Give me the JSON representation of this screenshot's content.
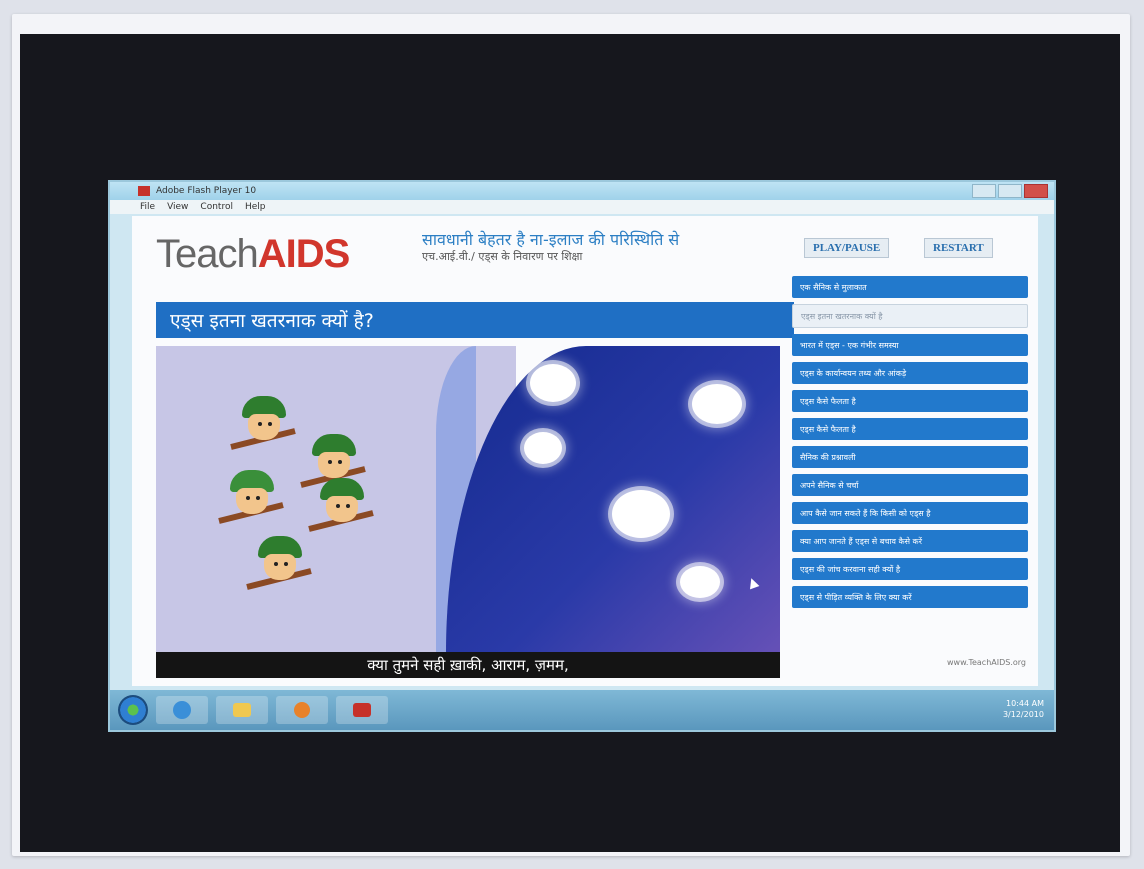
{
  "window": {
    "title": "Adobe Flash Player 10",
    "menu": [
      "File",
      "View",
      "Control",
      "Help"
    ]
  },
  "app": {
    "logo_teach": "Teach",
    "logo_aids": "AIDS",
    "tagline_line1": "सावधानी बेहतर है ना-इलाज की परिस्थिति से",
    "tagline_line2": "एच.आई.वी./ एड्स के निवारण पर शिक्षा",
    "play_pause": "PLAY/PAUSE",
    "restart": "RESTART",
    "question": "एड्स इतना खतरनाक क्यों है?",
    "subtitle": "क्या तुमने सही ख़ाकी, आराम, ज़मम,",
    "website": "www.TeachAIDS.org"
  },
  "sidebar": {
    "items": [
      {
        "label": "एक सैनिक से मुलाकात",
        "state": "active"
      },
      {
        "label": "एड्स इतना खतरनाक क्यों है",
        "state": "alt"
      },
      {
        "label": "भारत में एड्स - एक गंभीर समस्या",
        "state": "active"
      },
      {
        "label": "एड्स के कार्यान्वयन तथ्य और आंकड़े",
        "state": "active"
      },
      {
        "label": "एड्स कैसे फैलता है",
        "state": "active"
      },
      {
        "label": "एड्स कैसे फैलता है",
        "state": "active"
      },
      {
        "label": "सैनिक की प्रश्नावली",
        "state": "active"
      },
      {
        "label": "अपने सैनिक से चर्चा",
        "state": "active"
      },
      {
        "label": "आप कैसे जान सकते हैं कि किसी को एड्स है",
        "state": "active"
      },
      {
        "label": "क्या आप जानते हैं एड्स से बचाव कैसे करें",
        "state": "active"
      },
      {
        "label": "एड्स की जांच करवाना सही क्यों है",
        "state": "active"
      },
      {
        "label": "एड्स से पीड़ित व्यक्ति के लिए क्या करें",
        "state": "active"
      }
    ]
  },
  "tray": {
    "time": "10:44 AM",
    "date": "3/12/2010"
  },
  "icons": [
    "windows-start-icon",
    "ie-icon",
    "folder-icon",
    "media-player-icon",
    "flash-icon"
  ]
}
